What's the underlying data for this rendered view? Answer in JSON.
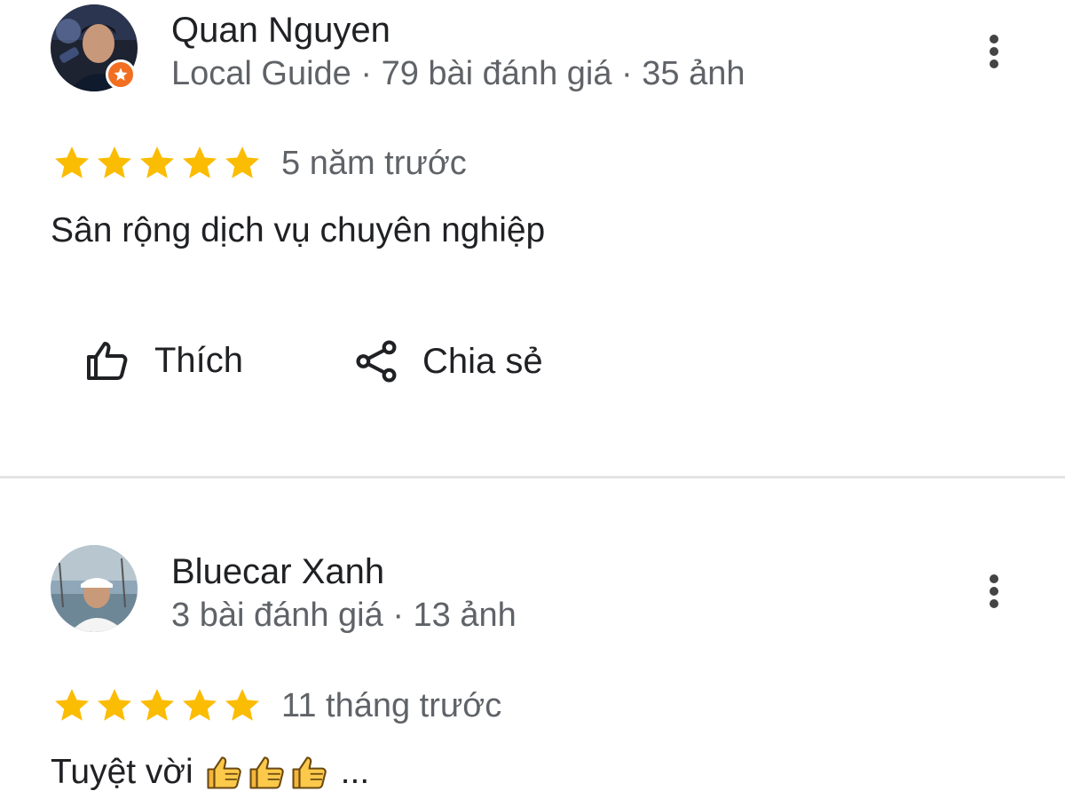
{
  "reviews": [
    {
      "name": "Quan Nguyen",
      "meta": "Local Guide · 79 bài đánh giá · 35 ảnh",
      "rating": 5,
      "time": "5 năm trước",
      "text": "Sân rộng dịch vụ chuyên nghiệp",
      "actions": {
        "like": "Thích",
        "share": "Chia sẻ"
      },
      "avatar_icon": "user-photo-avatar",
      "badge_icon": "local-guide-star-badge"
    },
    {
      "name": "Bluecar Xanh",
      "meta": "3 bài đánh giá · 13 ảnh",
      "rating": 5,
      "time": "11 tháng trước",
      "text": "Tuyệt vời",
      "text_suffix": "...",
      "emoji": [
        "thumbs-up-emoji",
        "thumbs-up-emoji",
        "thumbs-up-emoji"
      ],
      "avatar_icon": "user-photo-avatar"
    }
  ],
  "colors": {
    "star": "#fbbc04",
    "primary_text": "#202124",
    "secondary_text": "#5f6368",
    "divider": "#e3e3e3",
    "badge": "#f26f21"
  }
}
